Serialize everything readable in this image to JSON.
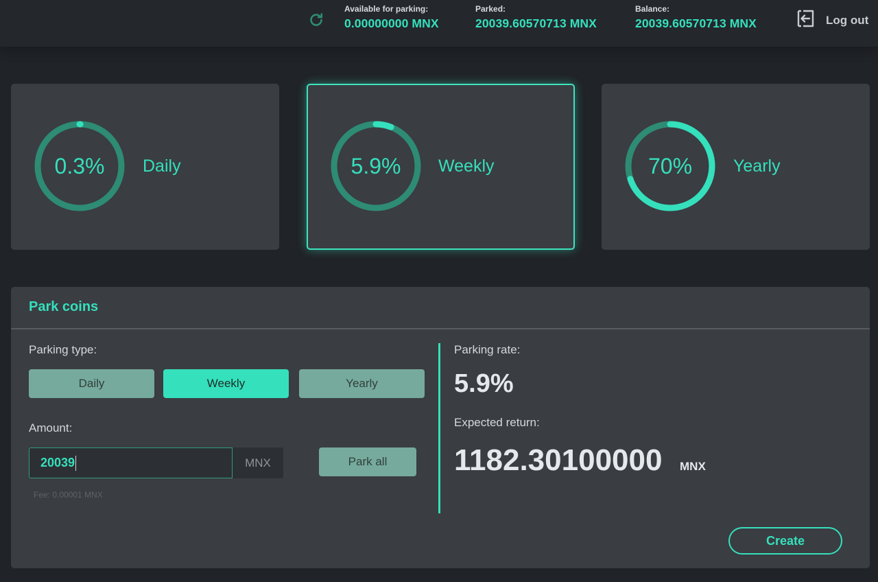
{
  "header": {
    "available_label": "Available for parking:",
    "available_value": "0.00000000 MNX",
    "parked_label": "Parked:",
    "parked_value": "20039.60570713 MNX",
    "balance_label": "Balance:",
    "balance_value": "20039.60570713 MNX",
    "logout_label": "Log out",
    "refresh_icon": "refresh-icon",
    "logout_icon": "logout-icon"
  },
  "rate_cards": [
    {
      "percent_text": "0.3%",
      "label": "Daily",
      "fill": 0.003,
      "selected": false
    },
    {
      "percent_text": "5.9%",
      "label": "Weekly",
      "fill": 0.059,
      "selected": true
    },
    {
      "percent_text": "70%",
      "label": "Yearly",
      "fill": 0.7,
      "selected": false
    }
  ],
  "park": {
    "title": "Park coins",
    "parking_type_label": "Parking type:",
    "types": [
      "Daily",
      "Weekly",
      "Yearly"
    ],
    "selected_type": "Weekly",
    "amount_label": "Amount:",
    "amount_value": "20039",
    "amount_unit": "MNX",
    "park_all_label": "Park all",
    "fee_text": "Fee: 0.00001 MNX",
    "rate_label": "Parking rate:",
    "rate_value": "5.9%",
    "return_label": "Expected return:",
    "return_value": "1182.30100000",
    "return_unit": "MNX",
    "create_label": "Create"
  },
  "colors": {
    "accent": "#35e0bc",
    "ring_track": "#2e8b74",
    "background": "#202328",
    "card": "#3a3d42"
  }
}
